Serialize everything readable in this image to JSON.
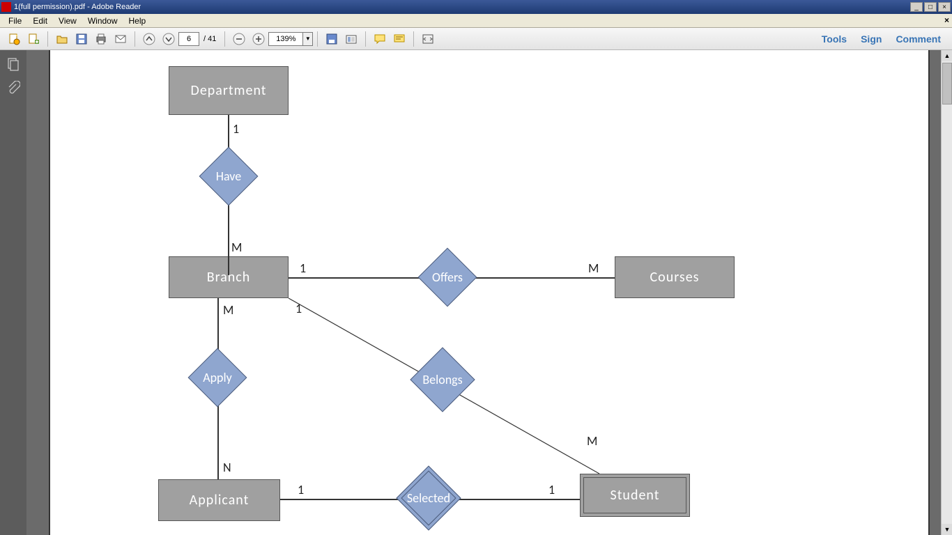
{
  "window": {
    "title": "1(full permission).pdf - Adobe Reader"
  },
  "menu": {
    "items": [
      "File",
      "Edit",
      "View",
      "Window",
      "Help"
    ]
  },
  "toolbar": {
    "page_current": "6",
    "page_total": "/ 41",
    "zoom": "139%",
    "right": {
      "tools": "Tools",
      "sign": "Sign",
      "comment": "Comment"
    }
  },
  "diagram": {
    "entities": {
      "department": "Department",
      "branch": "Branch",
      "courses": "Courses",
      "applicant": "Applicant",
      "student": "Student"
    },
    "relationships": {
      "have": "Have",
      "offers": "Offers",
      "apply": "Apply",
      "belongs": "Belongs",
      "selected": "Selected"
    },
    "cardinalities": {
      "dept_have": "1",
      "have_branch": "M",
      "branch_offers": "1",
      "offers_courses": "M",
      "branch_apply": "M",
      "apply_applicant": "N",
      "branch_belongs": "1",
      "belongs_student": "M",
      "applicant_selected": "1",
      "selected_student": "1"
    }
  }
}
